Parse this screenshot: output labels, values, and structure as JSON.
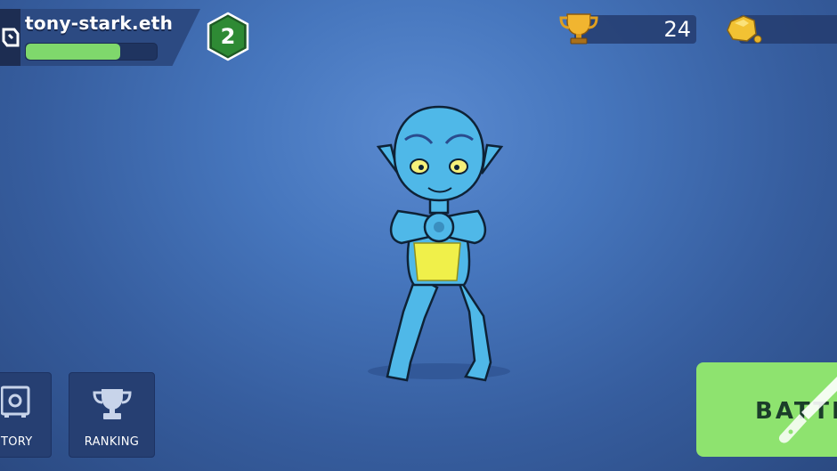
{
  "player": {
    "username": "tony-stark.eth",
    "xp_progress": 0.72,
    "level": "2",
    "avatar_icon": "brand-logo-icon"
  },
  "currencies": {
    "trophies": "24",
    "trophy_icon": "trophy-icon",
    "gold": "",
    "gold_icon": "gold-nugget-icon"
  },
  "menu": {
    "inventory_label": "NTORY",
    "inventory_icon": "safe-icon",
    "ranking_label": "RANKING",
    "ranking_icon": "trophy-outline-icon"
  },
  "battle": {
    "label": "BATTL",
    "icon": "knife-icon"
  },
  "colors": {
    "background": "#4676bd",
    "xp_fill": "#7fd86c",
    "level_badge": "#2e7d32",
    "battle_button": "#8ee36f",
    "panel": "#263f72"
  }
}
